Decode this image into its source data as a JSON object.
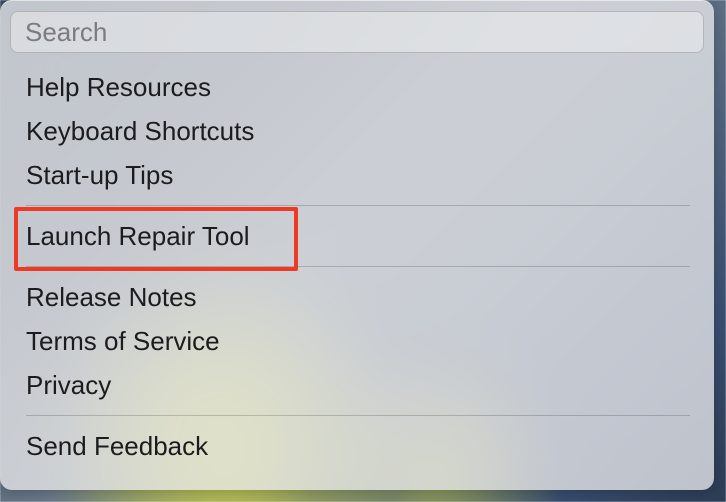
{
  "search": {
    "placeholder": "Search",
    "value": ""
  },
  "menu": {
    "group1": {
      "help_resources": "Help Resources",
      "keyboard_shortcuts": "Keyboard Shortcuts",
      "startup_tips": "Start-up Tips"
    },
    "group2": {
      "launch_repair_tool": "Launch Repair Tool"
    },
    "group3": {
      "release_notes": "Release Notes",
      "terms_of_service": "Terms of Service",
      "privacy": "Privacy"
    },
    "group4": {
      "send_feedback": "Send Feedback"
    }
  },
  "highlight": {
    "target": "launch-repair-tool",
    "color": "#ee3a24"
  }
}
